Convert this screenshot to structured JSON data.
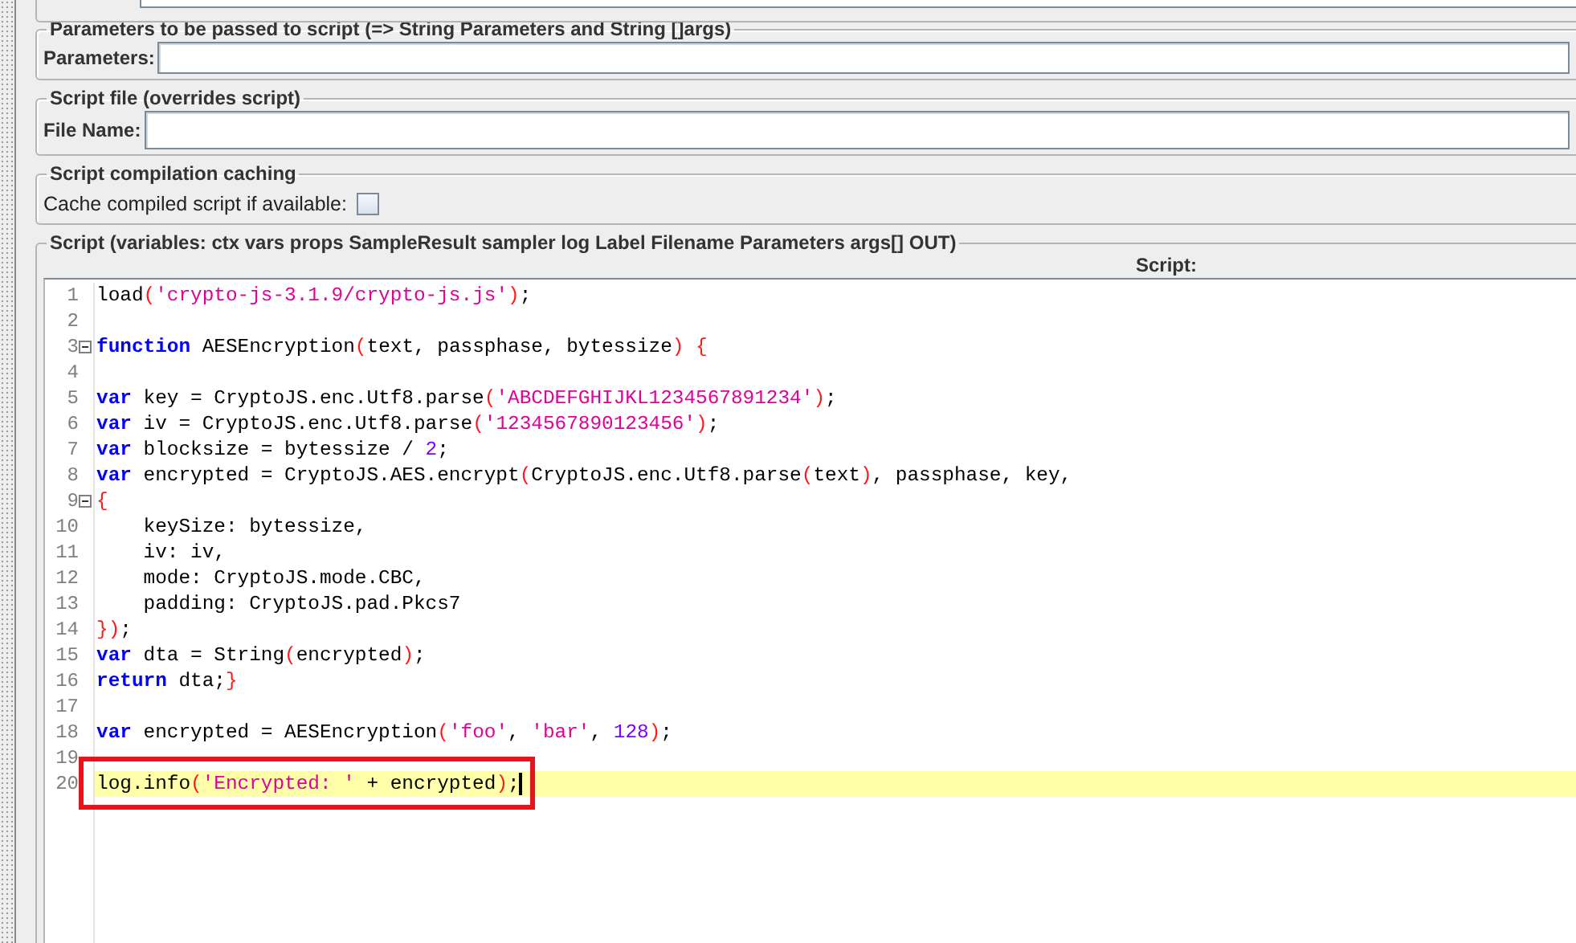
{
  "parameters_group": {
    "title": "Parameters to be passed to script (=> String Parameters and String []args)",
    "label": "Parameters:"
  },
  "script_file_group": {
    "title": "Script file (overrides script)",
    "label": "File Name:"
  },
  "caching_group": {
    "title": "Script compilation caching",
    "label": "Cache compiled script if available:",
    "checked": false
  },
  "script_group": {
    "title": "Script (variables: ctx vars props SampleResult sampler log Label Filename Parameters args[] OUT)",
    "header": "Script:",
    "lines": [
      {
        "number": "1",
        "fold": false,
        "current": false,
        "boxed": false,
        "tokens": [
          {
            "kind": "plain",
            "text": "load"
          },
          {
            "kind": "paren",
            "text": "("
          },
          {
            "kind": "string",
            "text": "'crypto-js-3.1.9/crypto-js.js'"
          },
          {
            "kind": "paren",
            "text": ")"
          },
          {
            "kind": "plain",
            "text": ";"
          }
        ]
      },
      {
        "number": "2",
        "fold": false,
        "current": false,
        "boxed": false
      },
      {
        "number": "3",
        "fold": true,
        "current": false,
        "boxed": false,
        "tokens": [
          {
            "kind": "keyword",
            "text": "function"
          },
          {
            "kind": "plain",
            "text": " AESEncryption"
          },
          {
            "kind": "paren",
            "text": "("
          },
          {
            "kind": "plain",
            "text": "text, passphase, bytessize"
          },
          {
            "kind": "paren",
            "text": ") {"
          }
        ]
      },
      {
        "number": "4",
        "fold": false,
        "current": false,
        "boxed": false
      },
      {
        "number": "5",
        "fold": false,
        "current": false,
        "boxed": false,
        "tokens": [
          {
            "kind": "keyword",
            "text": "var"
          },
          {
            "kind": "plain",
            "text": " key = CryptoJS.enc.Utf8.parse"
          },
          {
            "kind": "paren",
            "text": "("
          },
          {
            "kind": "string",
            "text": "'ABCDEFGHIJKL1234567891234'"
          },
          {
            "kind": "paren",
            "text": ")"
          },
          {
            "kind": "plain",
            "text": ";"
          }
        ]
      },
      {
        "number": "6",
        "fold": false,
        "current": false,
        "boxed": false,
        "tokens": [
          {
            "kind": "keyword",
            "text": "var"
          },
          {
            "kind": "plain",
            "text": " iv = CryptoJS.enc.Utf8.parse"
          },
          {
            "kind": "paren",
            "text": "("
          },
          {
            "kind": "string",
            "text": "'1234567890123456'"
          },
          {
            "kind": "paren",
            "text": ")"
          },
          {
            "kind": "plain",
            "text": ";"
          }
        ]
      },
      {
        "number": "7",
        "fold": false,
        "current": false,
        "boxed": false,
        "tokens": [
          {
            "kind": "keyword",
            "text": "var"
          },
          {
            "kind": "plain",
            "text": " blocksize = bytessize / "
          },
          {
            "kind": "number",
            "text": "2"
          },
          {
            "kind": "plain",
            "text": ";"
          }
        ]
      },
      {
        "number": "8",
        "fold": false,
        "current": false,
        "boxed": false,
        "tokens": [
          {
            "kind": "keyword",
            "text": "var"
          },
          {
            "kind": "plain",
            "text": " encrypted = CryptoJS.AES.encrypt"
          },
          {
            "kind": "paren",
            "text": "("
          },
          {
            "kind": "plain",
            "text": "CryptoJS.enc.Utf8.parse"
          },
          {
            "kind": "paren",
            "text": "("
          },
          {
            "kind": "plain",
            "text": "text"
          },
          {
            "kind": "paren",
            "text": ")"
          },
          {
            "kind": "plain",
            "text": ", passphase, key,"
          }
        ]
      },
      {
        "number": "9",
        "fold": true,
        "current": false,
        "boxed": false,
        "tokens": [
          {
            "kind": "paren",
            "text": "{"
          }
        ]
      },
      {
        "number": "10",
        "fold": false,
        "current": false,
        "boxed": false,
        "tokens": [
          {
            "kind": "plain",
            "text": "    keySize: bytessize,"
          }
        ]
      },
      {
        "number": "11",
        "fold": false,
        "current": false,
        "boxed": false,
        "tokens": [
          {
            "kind": "plain",
            "text": "    iv: iv,"
          }
        ]
      },
      {
        "number": "12",
        "fold": false,
        "current": false,
        "boxed": false,
        "tokens": [
          {
            "kind": "plain",
            "text": "    mode: CryptoJS.mode.CBC,"
          }
        ]
      },
      {
        "number": "13",
        "fold": false,
        "current": false,
        "boxed": false,
        "tokens": [
          {
            "kind": "plain",
            "text": "    padding: CryptoJS.pad.Pkcs7"
          }
        ]
      },
      {
        "number": "14",
        "fold": false,
        "current": false,
        "boxed": false,
        "tokens": [
          {
            "kind": "paren",
            "text": "})"
          },
          {
            "kind": "plain",
            "text": ";"
          }
        ]
      },
      {
        "number": "15",
        "fold": false,
        "current": false,
        "boxed": false,
        "tokens": [
          {
            "kind": "keyword",
            "text": "var"
          },
          {
            "kind": "plain",
            "text": " dta = String"
          },
          {
            "kind": "paren",
            "text": "("
          },
          {
            "kind": "plain",
            "text": "encrypted"
          },
          {
            "kind": "paren",
            "text": ")"
          },
          {
            "kind": "plain",
            "text": ";"
          }
        ]
      },
      {
        "number": "16",
        "fold": false,
        "current": false,
        "boxed": false,
        "tokens": [
          {
            "kind": "keyword",
            "text": "return"
          },
          {
            "kind": "plain",
            "text": " dta;"
          },
          {
            "kind": "paren",
            "text": "}"
          }
        ]
      },
      {
        "number": "17",
        "fold": false,
        "current": false,
        "boxed": false
      },
      {
        "number": "18",
        "fold": false,
        "current": false,
        "boxed": false,
        "tokens": [
          {
            "kind": "keyword",
            "text": "var"
          },
          {
            "kind": "plain",
            "text": " encrypted = AESEncryption"
          },
          {
            "kind": "paren",
            "text": "("
          },
          {
            "kind": "string",
            "text": "'foo'"
          },
          {
            "kind": "plain",
            "text": ", "
          },
          {
            "kind": "string",
            "text": "'bar'"
          },
          {
            "kind": "plain",
            "text": ", "
          },
          {
            "kind": "number",
            "text": "128"
          },
          {
            "kind": "paren",
            "text": ")"
          },
          {
            "kind": "plain",
            "text": ";"
          }
        ]
      },
      {
        "number": "19",
        "fold": false,
        "current": false,
        "boxed": false
      },
      {
        "number": "20",
        "fold": false,
        "current": true,
        "boxed": true,
        "tokens": [
          {
            "kind": "plain",
            "text": "log.info"
          },
          {
            "kind": "paren",
            "text": "("
          },
          {
            "kind": "string",
            "text": "'Encrypted: '"
          },
          {
            "kind": "plain",
            "text": " + encrypted"
          },
          {
            "kind": "paren",
            "text": ")"
          },
          {
            "kind": "plain",
            "text": ";"
          }
        ]
      }
    ]
  }
}
